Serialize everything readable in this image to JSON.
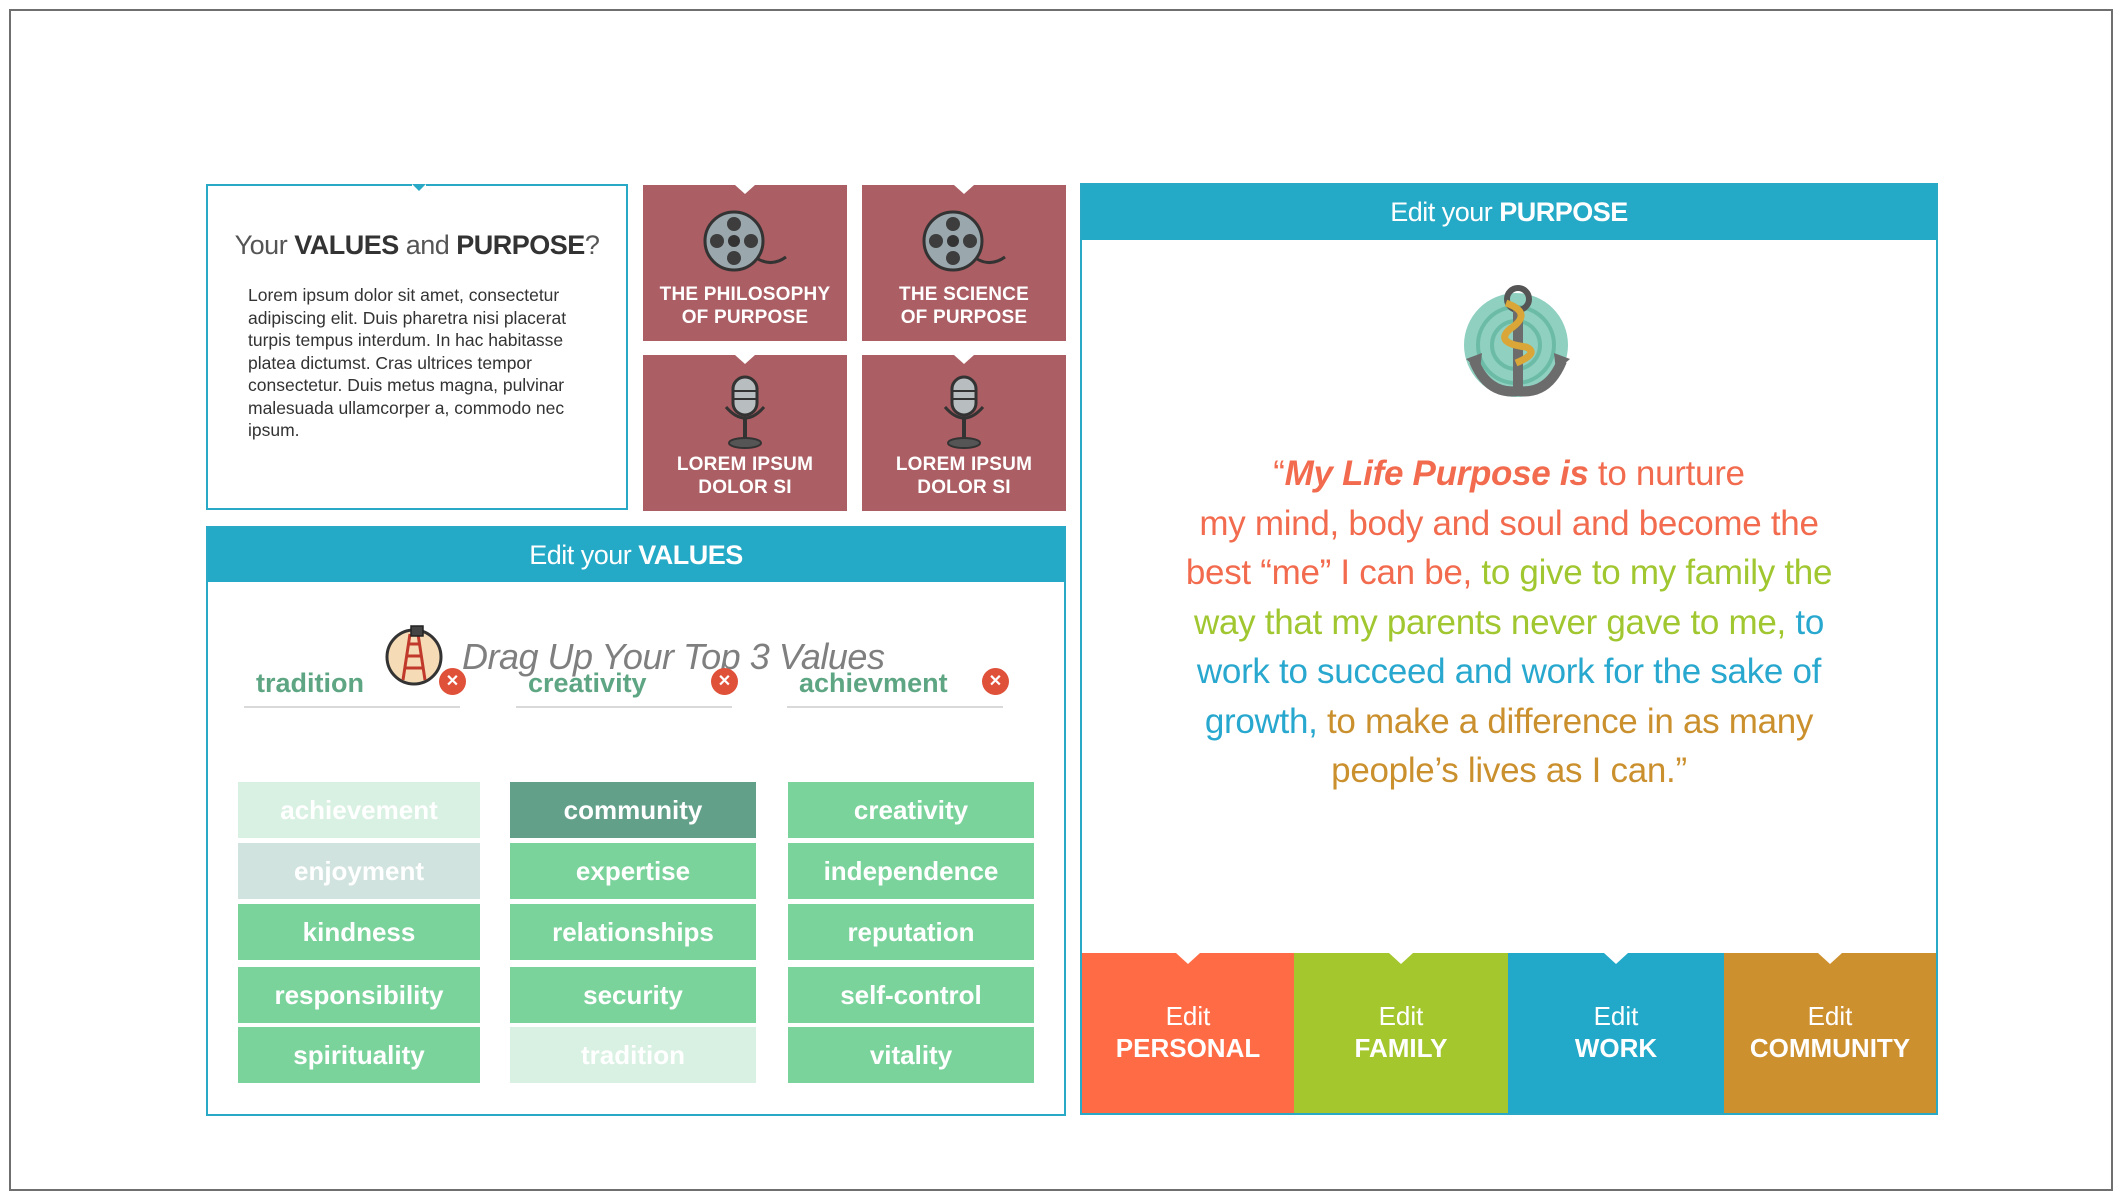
{
  "intro": {
    "title_pre": "Your ",
    "title_values": "VALUES",
    "title_mid": " and ",
    "title_purpose": "PURPOSE",
    "title_post": "?",
    "body": "Lorem ipsum dolor sit amet, consectetur adipiscing elit. Duis pharetra nisi placerat turpis tempus interdum. In hac habitasse platea dictumst. Cras ultrices tempor consectetur. Duis metus magna, pulvinar malesuada ullamcorper a, commodo nec ipsum."
  },
  "media": [
    {
      "line1": "THE PHILOSOPHY",
      "line2": "OF PURPOSE",
      "icon": "film-reel-icon"
    },
    {
      "line1": "THE SCIENCE",
      "line2": "OF PURPOSE",
      "icon": "film-reel-icon"
    },
    {
      "line1": "LOREM IPSUM",
      "line2": "DOLOR SI",
      "icon": "microphone-icon"
    },
    {
      "line1": "LOREM IPSUM",
      "line2": "DOLOR SI",
      "icon": "microphone-icon"
    }
  ],
  "values_panel": {
    "head_pre": "Edit your ",
    "head_bold": "VALUES",
    "drag_text": "Drag Up Your Top 3 Values",
    "picks": [
      "tradition",
      "creativity",
      "achievment"
    ],
    "columns": [
      [
        "achievement",
        "enjoyment",
        "kindness",
        "responsibility",
        "spirituality"
      ],
      [
        "community",
        "expertise",
        "relationships",
        "security",
        "tradition"
      ],
      [
        "creativity",
        "independence",
        "reputation",
        "self-control",
        "vitality"
      ]
    ]
  },
  "purpose_panel": {
    "head_pre": "Edit your ",
    "head_bold": "PURPOSE",
    "quote_open": "“",
    "quote_lead": "My Life Purpose is",
    "quote_personal_a": " to nurture",
    "quote_personal_b": "my mind, body and soul and become the",
    "quote_personal_c": "best “me” I can be,",
    "quote_family_a": " to give to my family the",
    "quote_family_b": "way that my parents never gave to me,",
    "quote_work_a": " to",
    "quote_work_b": "work to succeed and work for the sake of",
    "quote_work_c": "growth,",
    "quote_comm_a": " to make a difference in as many",
    "quote_comm_b": "people’s lives as I can.”",
    "tabs": [
      {
        "edit": "Edit",
        "label": "PERSONAL",
        "color": "#ff6b45"
      },
      {
        "edit": "Edit",
        "label": "FAMILY",
        "color": "#a3c72d"
      },
      {
        "edit": "Edit",
        "label": "WORK",
        "color": "#22a9c9"
      },
      {
        "edit": "Edit",
        "label": "COMMUNITY",
        "color": "#cd902f"
      }
    ]
  },
  "colors": {
    "accent": "#24a9c7",
    "tile": "#ab5e63",
    "value_green": "#7bd39c",
    "pick_green": "#5ea683",
    "remove_red": "#e0513a"
  }
}
